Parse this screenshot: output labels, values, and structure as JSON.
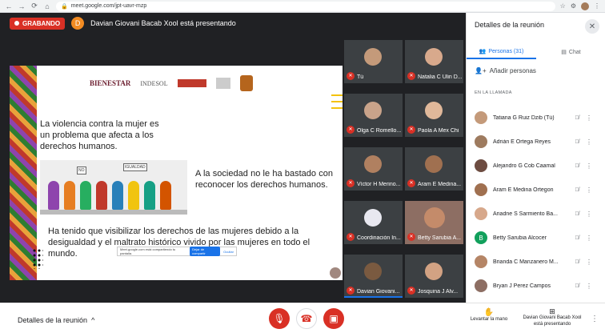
{
  "browser": {
    "url": "meet.google.com/jpt-uavr-mzp",
    "nav_back": "←",
    "nav_fwd": "→",
    "nav_reload": "⟳",
    "nav_home": "⌂",
    "lock": "🔒",
    "star": "☆",
    "ext": "⚙",
    "menu": "⋮"
  },
  "top": {
    "recording_label": "GRABANDO",
    "presenter_initial": "D",
    "presenter_text": "Davian Giovani Bacab Xool está presentando"
  },
  "slide": {
    "logo_bienestar": "BIENESTAR",
    "logo_indesol": "INDESOL",
    "text1": "La violencia contra la mujer es un problema que afecta a los derechos humanos.",
    "text2": "A la sociedad no le ha bastado con reconocer los derechos humanos.",
    "text3": "Ha tenido que visibilizar los derechos de las mujeres debido a la desigualdad y el maltrato histórico vivido por las mujeres en todo el mundo.",
    "illus_sign1": "IGUALDAD",
    "illus_sign2": "NO",
    "share_bar_text": "Meet.google.com está compartiendo tu pantalla.",
    "share_stop": "Dejar de compartir",
    "share_hide": "Ocultar"
  },
  "tiles": [
    {
      "name": "Tú",
      "face": "#c49a7a"
    },
    {
      "name": "Natalia C Ulin D...",
      "face": "#d8a98c"
    },
    {
      "name": "Olga C Romello...",
      "face": "#c9a38a"
    },
    {
      "name": "Paola A Mex Chi",
      "face": "#e0b89a"
    },
    {
      "name": "Víctor H Merino...",
      "face": "#b08060"
    },
    {
      "name": "Aram E Medina...",
      "face": "#a07050"
    },
    {
      "name": "Coordinación In...",
      "face": "#e8e8f0"
    },
    {
      "name": "Betty Sarubia A...",
      "face": "#c48b6a"
    },
    {
      "name": "Davian Giovani...",
      "face": "#7a5a40"
    },
    {
      "name": "Josquina J Alv...",
      "face": "#d2a283"
    }
  ],
  "panel": {
    "title": "Detalles de la reunión",
    "close_icon": "✕",
    "tab_people": "Personas (31)",
    "tab_chat": "Chat",
    "add_people": "Añadir personas",
    "section": "EN LA LLAMADA",
    "people": [
      {
        "name": "Tatiana G Ruiz Dzib (Tú)",
        "color": "#c49a7a"
      },
      {
        "name": "Adrián E Ortega Reyes",
        "color": "#9e7b5f"
      },
      {
        "name": "Alejandro G Cob Caamal",
        "color": "#6d4c41"
      },
      {
        "name": "Aram E Medina Ortegon",
        "color": "#a07050"
      },
      {
        "name": "Ariadne S Sarmiento Ba...",
        "color": "#d7a88b"
      },
      {
        "name": "Betty Sarubia Alcocer",
        "color": "#12a05c",
        "letter": "B"
      },
      {
        "name": "Brianda C Manzanero M...",
        "color": "#b58566"
      },
      {
        "name": "Bryan J Perez Campos",
        "color": "#8d6e63"
      }
    ],
    "mic_off_icon": "🎙̸",
    "more_icon": "⋮"
  },
  "bottom": {
    "details_label": "Detalles de la reunión",
    "chevron_up_icon": "^",
    "raise_hand_label": "Levantar la mano",
    "raise_hand_icon": "✋",
    "presenting_label": "Davian Giovani Bacab Xool está presentando",
    "presenting_icon": "⊞",
    "mic_icon": "🎙",
    "end_icon": "☎",
    "cam_icon": "▣",
    "more_icon": "⋮"
  }
}
